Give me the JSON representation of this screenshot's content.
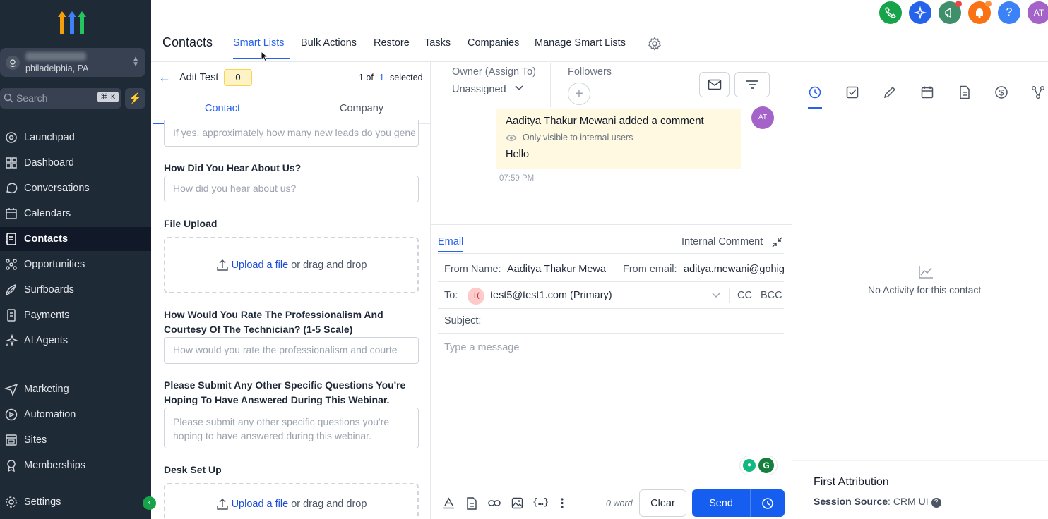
{
  "sidebar": {
    "location": {
      "city": "philadelphia, PA"
    },
    "search": {
      "placeholder": "Search",
      "shortcut": "⌘ K"
    },
    "items_top": [
      {
        "label": "Launchpad",
        "icon": "launchpad-icon"
      },
      {
        "label": "Dashboard",
        "icon": "dashboard-icon"
      },
      {
        "label": "Conversations",
        "icon": "chat-icon"
      },
      {
        "label": "Calendars",
        "icon": "calendar-icon"
      },
      {
        "label": "Contacts",
        "icon": "contacts-icon",
        "active": true
      },
      {
        "label": "Opportunities",
        "icon": "opportunities-icon"
      },
      {
        "label": "Surfboards",
        "icon": "surfboard-icon"
      },
      {
        "label": "Payments",
        "icon": "payments-icon"
      },
      {
        "label": "AI Agents",
        "icon": "sparkle-icon"
      }
    ],
    "items_bottom": [
      {
        "label": "Marketing",
        "icon": "send-icon"
      },
      {
        "label": "Automation",
        "icon": "automation-icon"
      },
      {
        "label": "Sites",
        "icon": "sites-icon"
      },
      {
        "label": "Memberships",
        "icon": "membership-icon"
      }
    ],
    "settings_label": "Settings"
  },
  "header": {
    "title": "Contacts",
    "tabs": [
      "Smart Lists",
      "Bulk Actions",
      "Restore",
      "Tasks",
      "Companies",
      "Manage Smart Lists"
    ],
    "active_tab": "Smart Lists",
    "user_initials": "AT"
  },
  "contact_panel": {
    "name": "Adit Test",
    "badge_count": "0",
    "pager_of": "1 of",
    "pager_total": "1",
    "pager_selected": "selected",
    "subtabs": [
      "Contact",
      "Company"
    ],
    "fields": {
      "leads_placeholder": "If yes, approximately how many new leads do you gene",
      "hear_label": "How Did You Hear About Us?",
      "hear_placeholder": "How did you hear about us?",
      "file_label": "File Upload",
      "upload_link": "Upload a file",
      "upload_text": "or drag and drop",
      "rate_label": "How Would You Rate The Professionalism And Courtesy Of The Technician? (1-5 Scale)",
      "rate_placeholder": "How would you rate the professionalism and courte",
      "questions_label": "Please Submit Any Other Specific Questions You're Hoping To Have Answered During This Webinar.",
      "questions_placeholder": "Please submit any other specific questions you're hoping to have answered during this webinar.",
      "desk_label": "Desk Set Up"
    }
  },
  "conversation": {
    "owner_label": "Owner (Assign To)",
    "owner_value": "Unassigned",
    "followers_label": "Followers",
    "comment": {
      "author": "Aaditya Thakur Mewani",
      "action": " added a comment",
      "visibility": "Only visible to internal users",
      "text": "Hello",
      "time": "07:59 PM",
      "avatar": "AT"
    }
  },
  "composer": {
    "tab_email": "Email",
    "tab_internal": "Internal Comment",
    "from_name_label": "From Name:",
    "from_name_value": "Aaditya Thakur Mewani",
    "from_email_label": "From email:",
    "from_email_value": "aditya.mewani@gohighlevel.com",
    "to_label": "To:",
    "to_avatar": "T(",
    "to_value": "test5@test1.com (Primary)",
    "cc": "CC",
    "bcc": "BCC",
    "subject_label": "Subject:",
    "message_placeholder": "Type a message",
    "word_count": "0 word",
    "clear_label": "Clear",
    "send_label": "Send"
  },
  "activity": {
    "empty_text": "No Activity for this contact",
    "attribution_title": "First Attribution",
    "session_source_label": "Session Source",
    "session_source_value": ": CRM UI"
  },
  "colors": {
    "sidebar_bg": "#1f2a37",
    "accent": "#2563eb",
    "send_button": "#155eef",
    "comment_bg": "#fef9e0"
  }
}
